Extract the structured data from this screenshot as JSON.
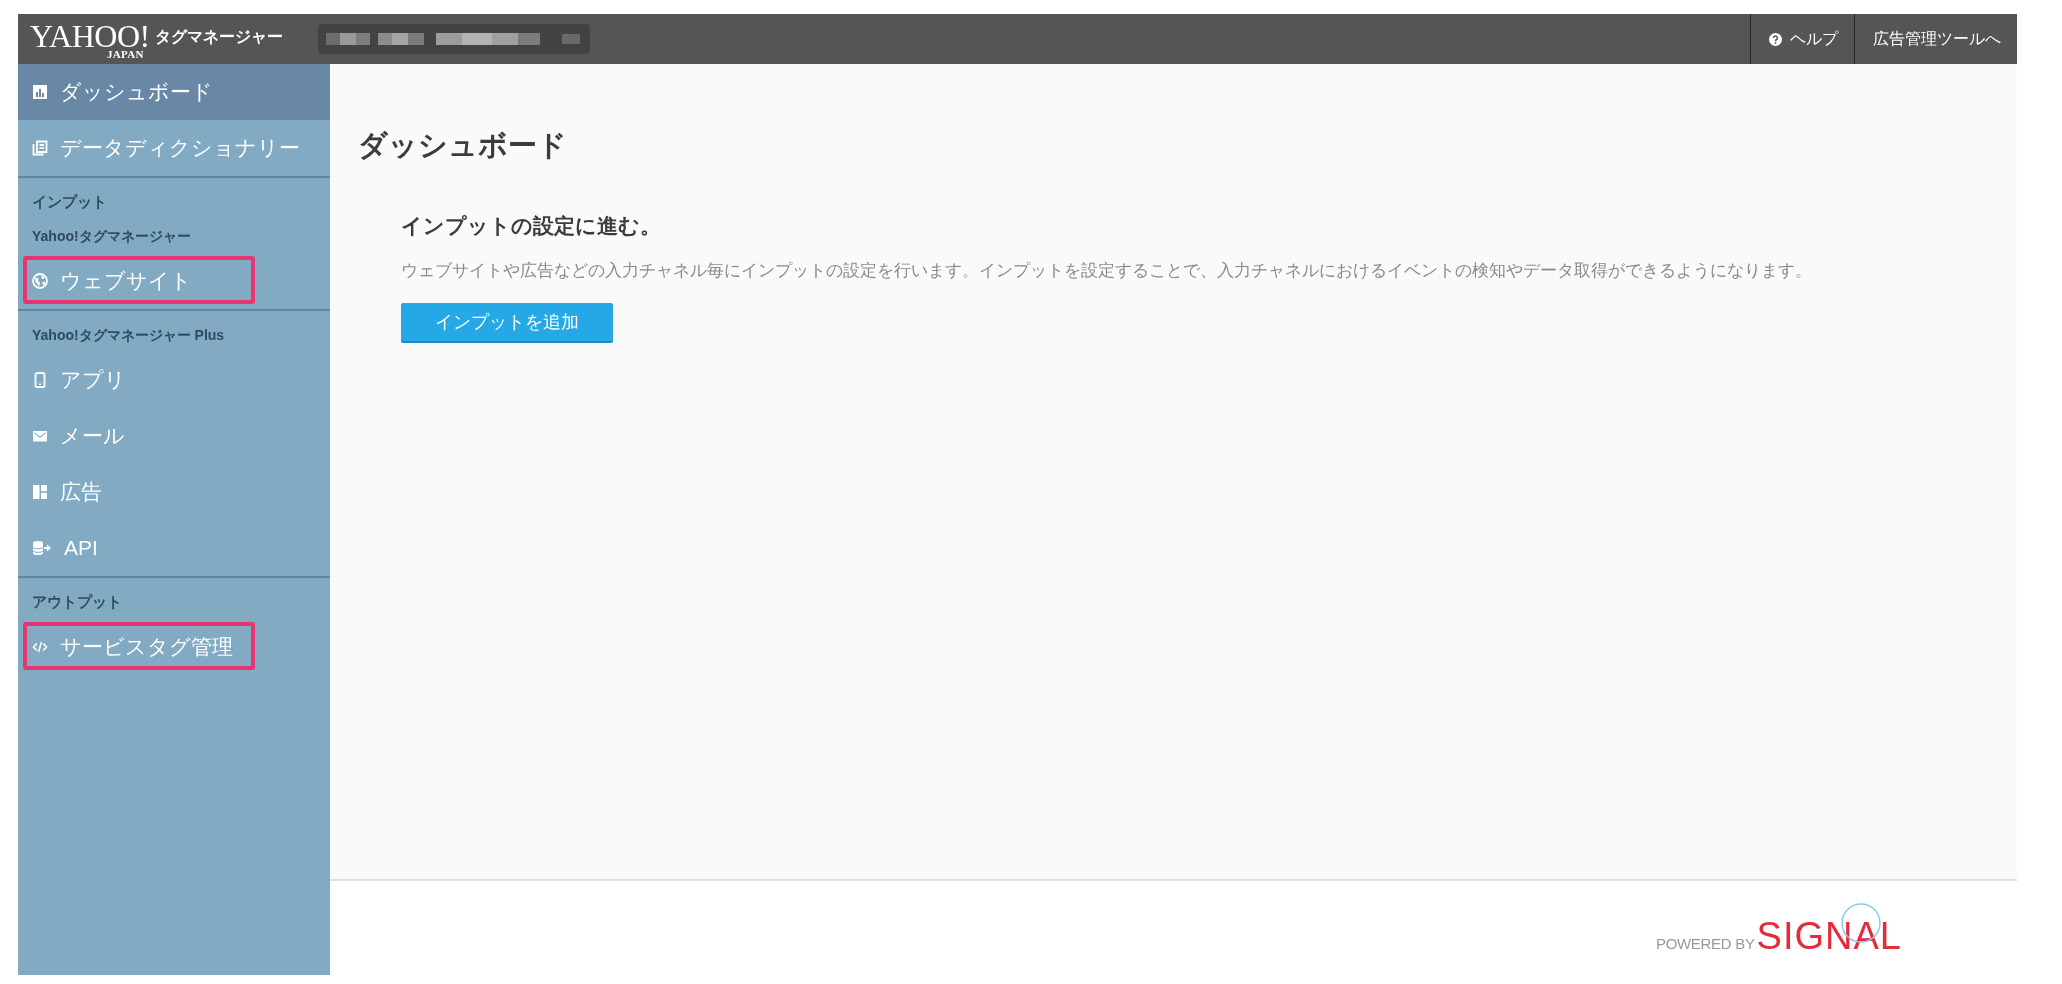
{
  "header": {
    "logo": {
      "brand": "YAHOO!",
      "region": "JAPAN",
      "product": "タグマネージャー"
    },
    "links": [
      {
        "kind": "help",
        "label": "ヘルプ"
      },
      {
        "kind": "plain",
        "label": "広告管理ツールへ"
      }
    ]
  },
  "sidebar": {
    "sections": [
      {
        "entries": [
          {
            "kind": "link",
            "label": "ダッシュボード",
            "selected": true,
            "highlighted": false
          },
          {
            "kind": "link",
            "label": "データディクショナリー",
            "selected": false,
            "highlighted": false
          }
        ]
      },
      {
        "entries": [
          {
            "kind": "heading",
            "label": "インプット"
          },
          {
            "kind": "subheading",
            "label": "Yahoo!タグマネージャー"
          },
          {
            "kind": "link",
            "label": "ウェブサイト",
            "selected": false,
            "highlighted": true
          }
        ]
      },
      {
        "entries": [
          {
            "kind": "subheading",
            "label": "Yahoo!タグマネージャー Plus"
          },
          {
            "kind": "link",
            "label": "アプリ",
            "selected": false,
            "highlighted": false
          },
          {
            "kind": "link",
            "label": "メール",
            "selected": false,
            "highlighted": false
          },
          {
            "kind": "link",
            "label": "広告",
            "selected": false,
            "highlighted": false
          },
          {
            "kind": "link",
            "label": "API",
            "selected": false,
            "highlighted": false
          }
        ]
      },
      {
        "entries": [
          {
            "kind": "heading",
            "label": "アウトプット"
          },
          {
            "kind": "link",
            "label": "サービスタグ管理",
            "selected": false,
            "highlighted": true
          }
        ]
      }
    ]
  },
  "main": {
    "title": "ダッシュボード",
    "intro": {
      "heading": "インプットの設定に進む。",
      "description": "ウェブサイトや広告などの入力チャネル毎にインプットの設定を行います。インプットを設定することで、入力チャネルにおけるイベントの検知やデータ取得ができるようになります。",
      "button": "インプットを追加"
    }
  },
  "footer": {
    "powered_by": "POWERED BY",
    "brand": "SIGNAL"
  }
}
